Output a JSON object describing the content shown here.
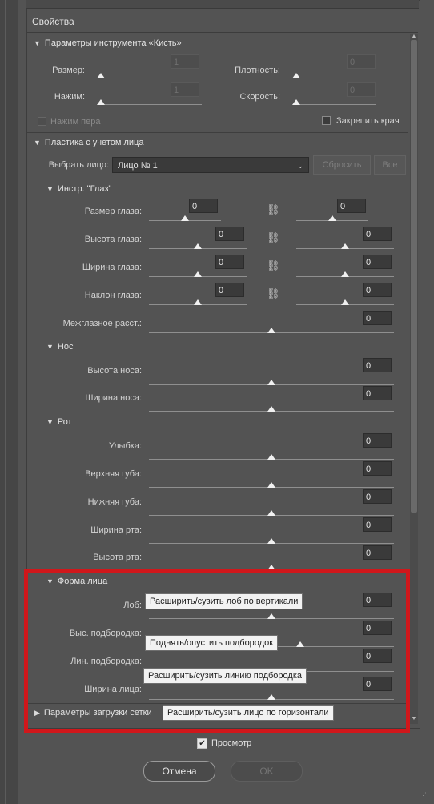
{
  "panel_title": "Свойства",
  "brush": {
    "header": "Параметры инструмента «Кисть»",
    "size_label": "Размер:",
    "size_value": "1",
    "density_label": "Плотность:",
    "density_value": "0",
    "pressure_label": "Нажим:",
    "pressure_value": "1",
    "speed_label": "Скорость:",
    "speed_value": "0",
    "stylus_pressure_label": "Нажим пера",
    "pin_edges_label": "Закрепить края"
  },
  "face_aware": {
    "header": "Пластика с учетом лица",
    "select_face_label": "Выбрать лицо:",
    "select_face_value": "Лицо № 1",
    "reset_label": "Сбросить",
    "all_label": "Все"
  },
  "eyes": {
    "header": "Инстр. \"Глаз\"",
    "rows": [
      {
        "label": "Размер глаза:",
        "left": "0",
        "right": "0"
      },
      {
        "label": "Высота глаза:",
        "left": "0",
        "right": "0"
      },
      {
        "label": "Ширина глаза:",
        "left": "0",
        "right": "0"
      },
      {
        "label": "Наклон глаза:",
        "left": "0",
        "right": "0"
      }
    ],
    "distance_label": "Межглазное расст.:",
    "distance_value": "0"
  },
  "nose": {
    "header": "Нос",
    "rows": [
      {
        "label": "Высота носа:",
        "value": "0"
      },
      {
        "label": "Ширина носа:",
        "value": "0"
      }
    ]
  },
  "mouth": {
    "header": "Рот",
    "rows": [
      {
        "label": "Улыбка:",
        "value": "0"
      },
      {
        "label": "Верхняя губа:",
        "value": "0"
      },
      {
        "label": "Нижняя губа:",
        "value": "0"
      },
      {
        "label": "Ширина рта:",
        "value": "0"
      },
      {
        "label": "Высота рта:",
        "value": "0"
      }
    ]
  },
  "face_shape": {
    "header": "Форма лица",
    "rows": [
      {
        "label": "Лоб:",
        "value": "0",
        "tooltip": "Расширить/сузить лоб по вертикали"
      },
      {
        "label": "Выс. подбородка:",
        "value": "0",
        "tooltip": "Поднять/опустить подбородок"
      },
      {
        "label": "Лин. подбородка:",
        "value": "0",
        "tooltip": "Расширить/сузить линию подбородка"
      },
      {
        "label": "Ширина лица:",
        "value": "0",
        "tooltip": "Расширить/сузить лицо по горизонтали"
      }
    ]
  },
  "mesh": {
    "header": "Параметры загрузки сетки"
  },
  "footer": {
    "preview_label": "Просмотр",
    "cancel_label": "Отмена",
    "ok_label": "OK"
  },
  "colors": {
    "highlight": "#d0171b",
    "tooltip_bg": "#f2f2f2"
  }
}
